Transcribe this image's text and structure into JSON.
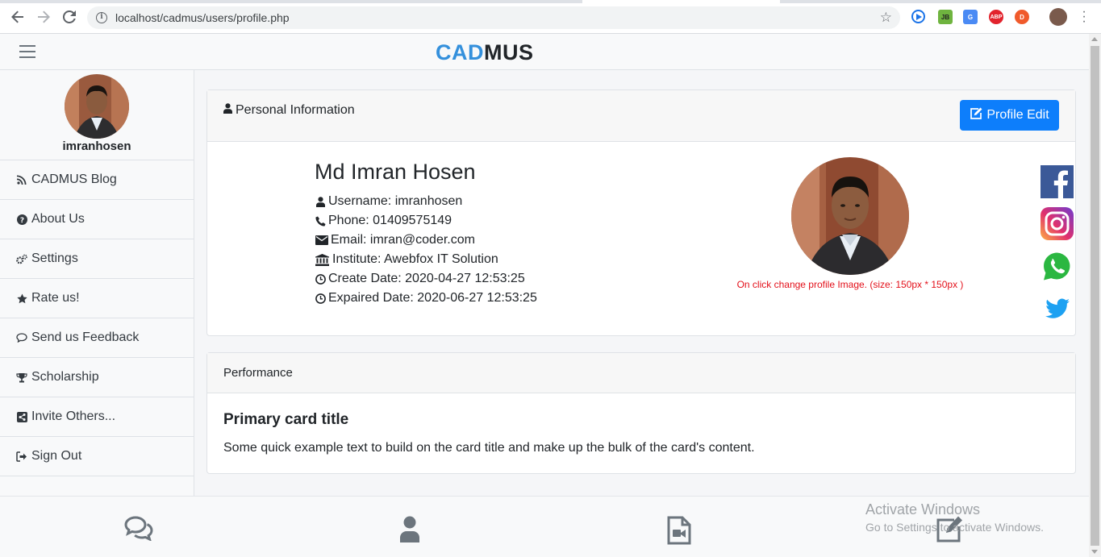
{
  "browser": {
    "url": "localhost/cadmus/users/profile.php"
  },
  "header": {
    "brand_part1": "CAD",
    "brand_part2": "MUS"
  },
  "sidebar": {
    "username": "imranhosen",
    "items": [
      {
        "label": "CADMUS Blog",
        "icon": "rss-icon"
      },
      {
        "label": "About Us",
        "icon": "question-circle-icon"
      },
      {
        "label": "Settings",
        "icon": "gears-icon"
      },
      {
        "label": "Rate us!",
        "icon": "star-icon"
      },
      {
        "label": "Send us Feedback",
        "icon": "comment-icon"
      },
      {
        "label": "Scholarship",
        "icon": "trophy-icon"
      },
      {
        "label": "Invite Others...",
        "icon": "share-icon"
      },
      {
        "label": "Sign Out",
        "icon": "sign-out-icon"
      }
    ]
  },
  "personal_info": {
    "header": "Personal Information",
    "edit_button": "Profile Edit",
    "fullname": "Md Imran Hosen",
    "username": "Username: imranhosen",
    "phone": "Phone: 01409575149",
    "email": "Email: imran@coder.com",
    "institute": "Institute: Awebfox IT Solution",
    "create_date": "Create Date: 2020-04-27 12:53:25",
    "expaired_date": "Expaired Date: 2020-06-27 12:53:25",
    "photo_hint": "On click change profile Image. (size: 150px * 150px )"
  },
  "performance": {
    "header": "Performance",
    "card_title": "Primary card title",
    "card_text": "Some quick example text to build on the card title and make up the bulk of the card's content."
  },
  "watermark": {
    "line1": "Activate Windows",
    "line2": "Go to Settings to activate Windows."
  },
  "colors": {
    "brand_accent": "#3490dc",
    "primary_button": "#0d7efb",
    "hint_red": "#e3101a"
  }
}
